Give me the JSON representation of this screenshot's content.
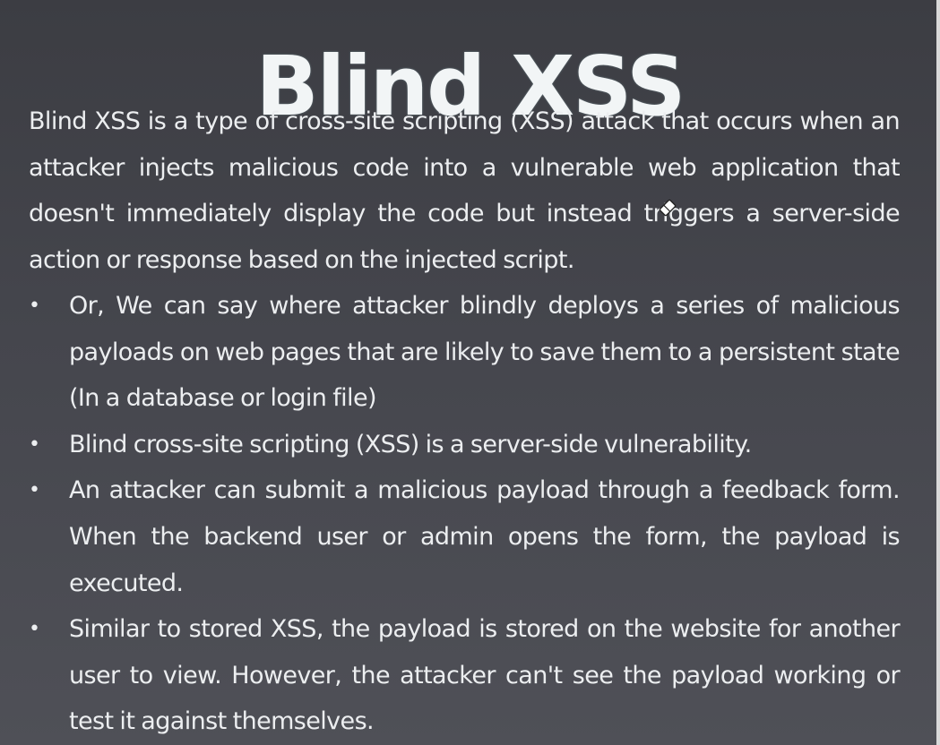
{
  "slide": {
    "title": "Blind XSS",
    "intro": "Blind XSS is a type of cross-site scripting (XSS) attack that occurs when an attacker injects malicious code into a vulnerable web application that doesn't immediately display the code but instead triggers a server-side action or response based on the injected script.",
    "bullet_glyph": "•",
    "bullets": [
      "Or, We can say where attacker blindly deploys a series of malicious payloads on web pages that are likely to save them to a persistent state (In a database or login file)",
      "Blind cross-site scripting (XSS) is a server-side vulnerability.",
      "An attacker can submit a malicious payload through a feedback form. When the backend user or admin opens the form, the payload is executed.",
      "Similar to stored XSS, the payload is stored on the website for another user to view. However, the attacker can't see the payload working or test it against themselves."
    ]
  },
  "icons": {
    "cursor": "eraser-cursor-icon"
  },
  "colors": {
    "background": "#45464d",
    "text": "#eceef0",
    "title": "#f2f5f6"
  }
}
